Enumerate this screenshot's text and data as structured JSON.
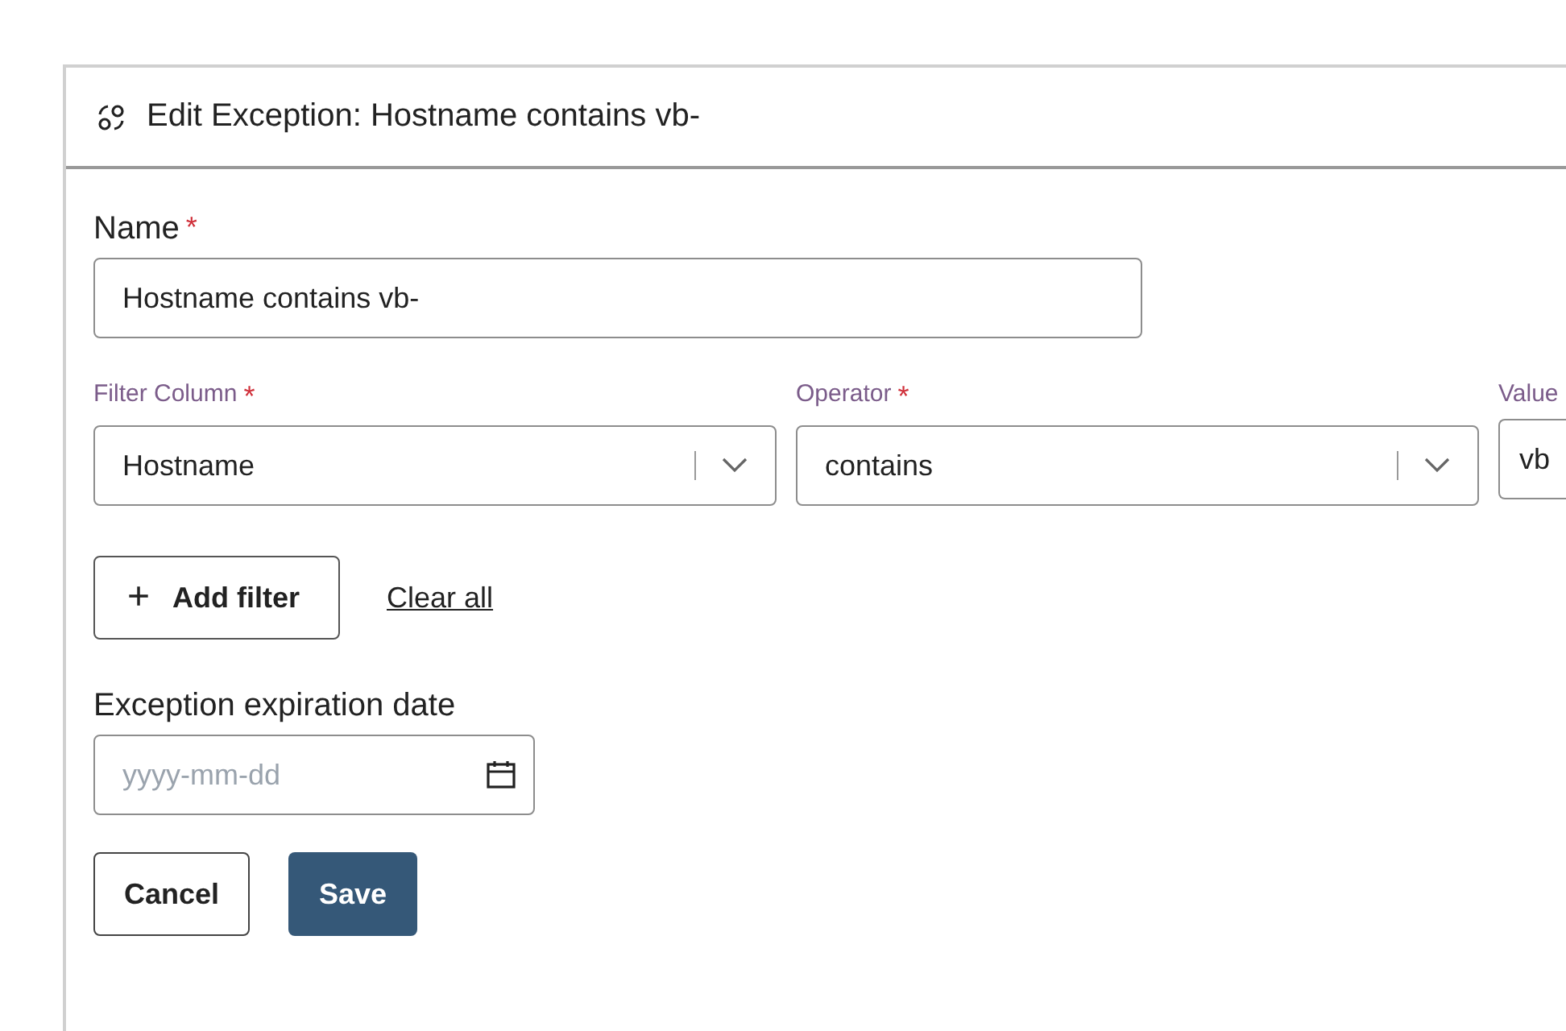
{
  "dialog": {
    "title": "Edit Exception: Hostname contains vb-"
  },
  "name_field": {
    "label": "Name",
    "required_mark": "*",
    "value": "Hostname contains vb-"
  },
  "filters": [
    {
      "kind": "select",
      "label": "Filter Column",
      "required_mark": "*",
      "value": "Hostname"
    },
    {
      "kind": "select",
      "label": "Operator",
      "required_mark": "*",
      "value": "contains"
    },
    {
      "kind": "text",
      "label": "Value",
      "value": "vb"
    }
  ],
  "add_filter_button": {
    "icon": "+",
    "label": "Add filter"
  },
  "clear_all_link": "Clear all",
  "expiration": {
    "label": "Exception expiration date",
    "placeholder": "yyyy-mm-dd"
  },
  "buttons": [
    {
      "kind": "secondary",
      "label": "Cancel"
    },
    {
      "kind": "primary",
      "label": "Save"
    }
  ]
}
